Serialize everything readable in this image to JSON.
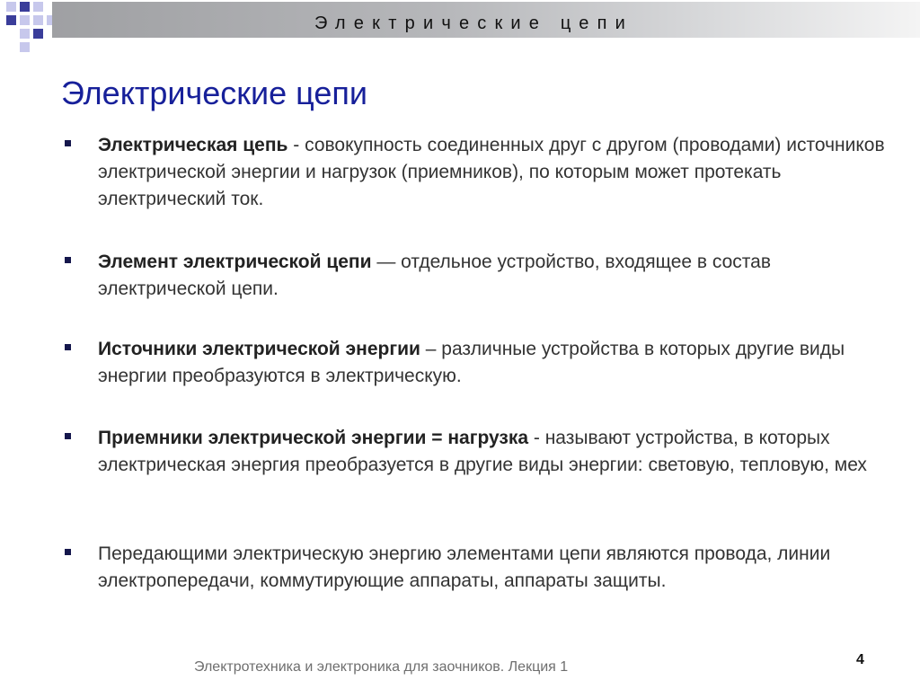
{
  "header": {
    "bar_title": "Электрические цепи"
  },
  "slide": {
    "title": "Электрические цепи",
    "bullets": [
      {
        "term": "Электрическая цепь",
        "text": " - совокупность соединенных друг с другом (проводами) источников электрической энергии и нагрузок (приемников), по которым может протекать электрический ток."
      },
      {
        "term": "Элемент электрической цепи",
        "text": " — отдельное устройство, входящее в состав электрической цепи."
      },
      {
        "term": "Источники электрической энергии",
        "text": " – различные устройства в которых другие виды энергии преобразуются в электрическую."
      },
      {
        "term": "Приемники электрической энергии = нагрузка",
        "text": " -  называют устройства, в которых электрическая энергия преобразуется в другие  виды энергии: световую, тепловую, мех"
      },
      {
        "term": "",
        "text": "Передающими электрическую энергию элементами цепи являются провода, линии электропередачи, коммутирующие аппараты, аппараты защиты."
      }
    ]
  },
  "footer": {
    "text": "Электротехника и электроника для заочников. Лекция 1",
    "page_number": "4"
  },
  "colors": {
    "title": "#17209a",
    "bullet_marker": "#15174c",
    "decor_dark": "#3a3d9a",
    "decor_light": "#c7c8ec"
  }
}
